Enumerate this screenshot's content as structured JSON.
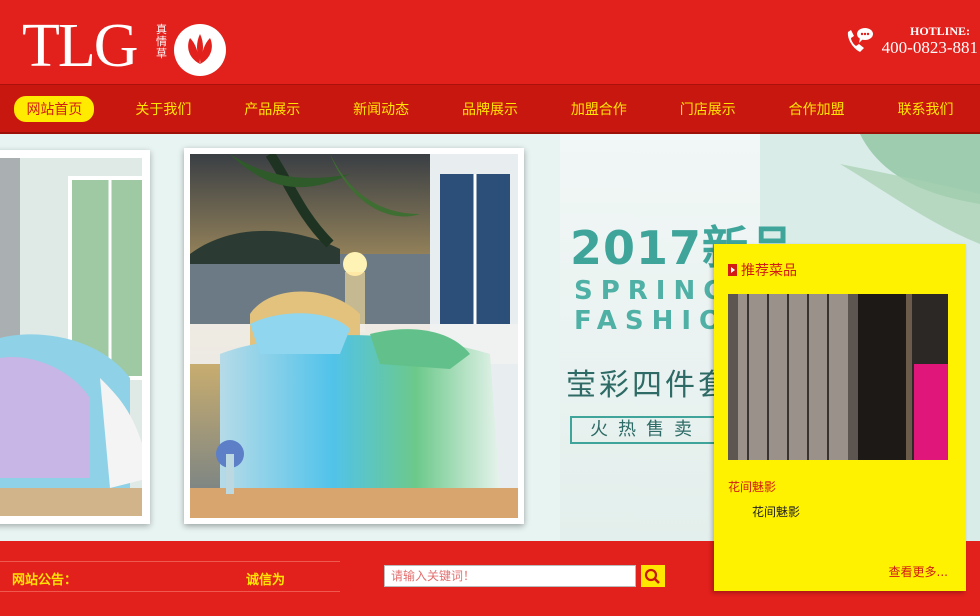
{
  "header": {
    "logo_text": "TLG",
    "logo_vertical": "真情草",
    "hotline_label": "HOTLINE:",
    "hotline_number": "400-0823-881"
  },
  "nav": {
    "items": [
      {
        "label": "网站首页",
        "active": true
      },
      {
        "label": "关于我们"
      },
      {
        "label": "产品展示"
      },
      {
        "label": "新闻动态"
      },
      {
        "label": "品牌展示"
      },
      {
        "label": "加盟合作"
      },
      {
        "label": "门店展示"
      },
      {
        "label": "合作加盟"
      },
      {
        "label": "联系我们"
      }
    ]
  },
  "banner": {
    "year_text": "2017新品",
    "spring_text": "SPRING",
    "fashion_text": "FASHION",
    "cn_title": "莹彩四件套",
    "cn_tag": "火热售卖"
  },
  "notice": {
    "label": "网站公告：",
    "text": "诚信为"
  },
  "search": {
    "placeholder": "请输入关键词！"
  },
  "recommend": {
    "title": "推荐菜品",
    "item_name": "花间魅影",
    "item_desc": "花间魅影",
    "more": "查看更多..."
  },
  "colors": {
    "brand_red": "#e2201c",
    "nav_red": "#c8170f",
    "accent_yellow": "#ffe600",
    "promo_teal": "#3fa59b"
  }
}
